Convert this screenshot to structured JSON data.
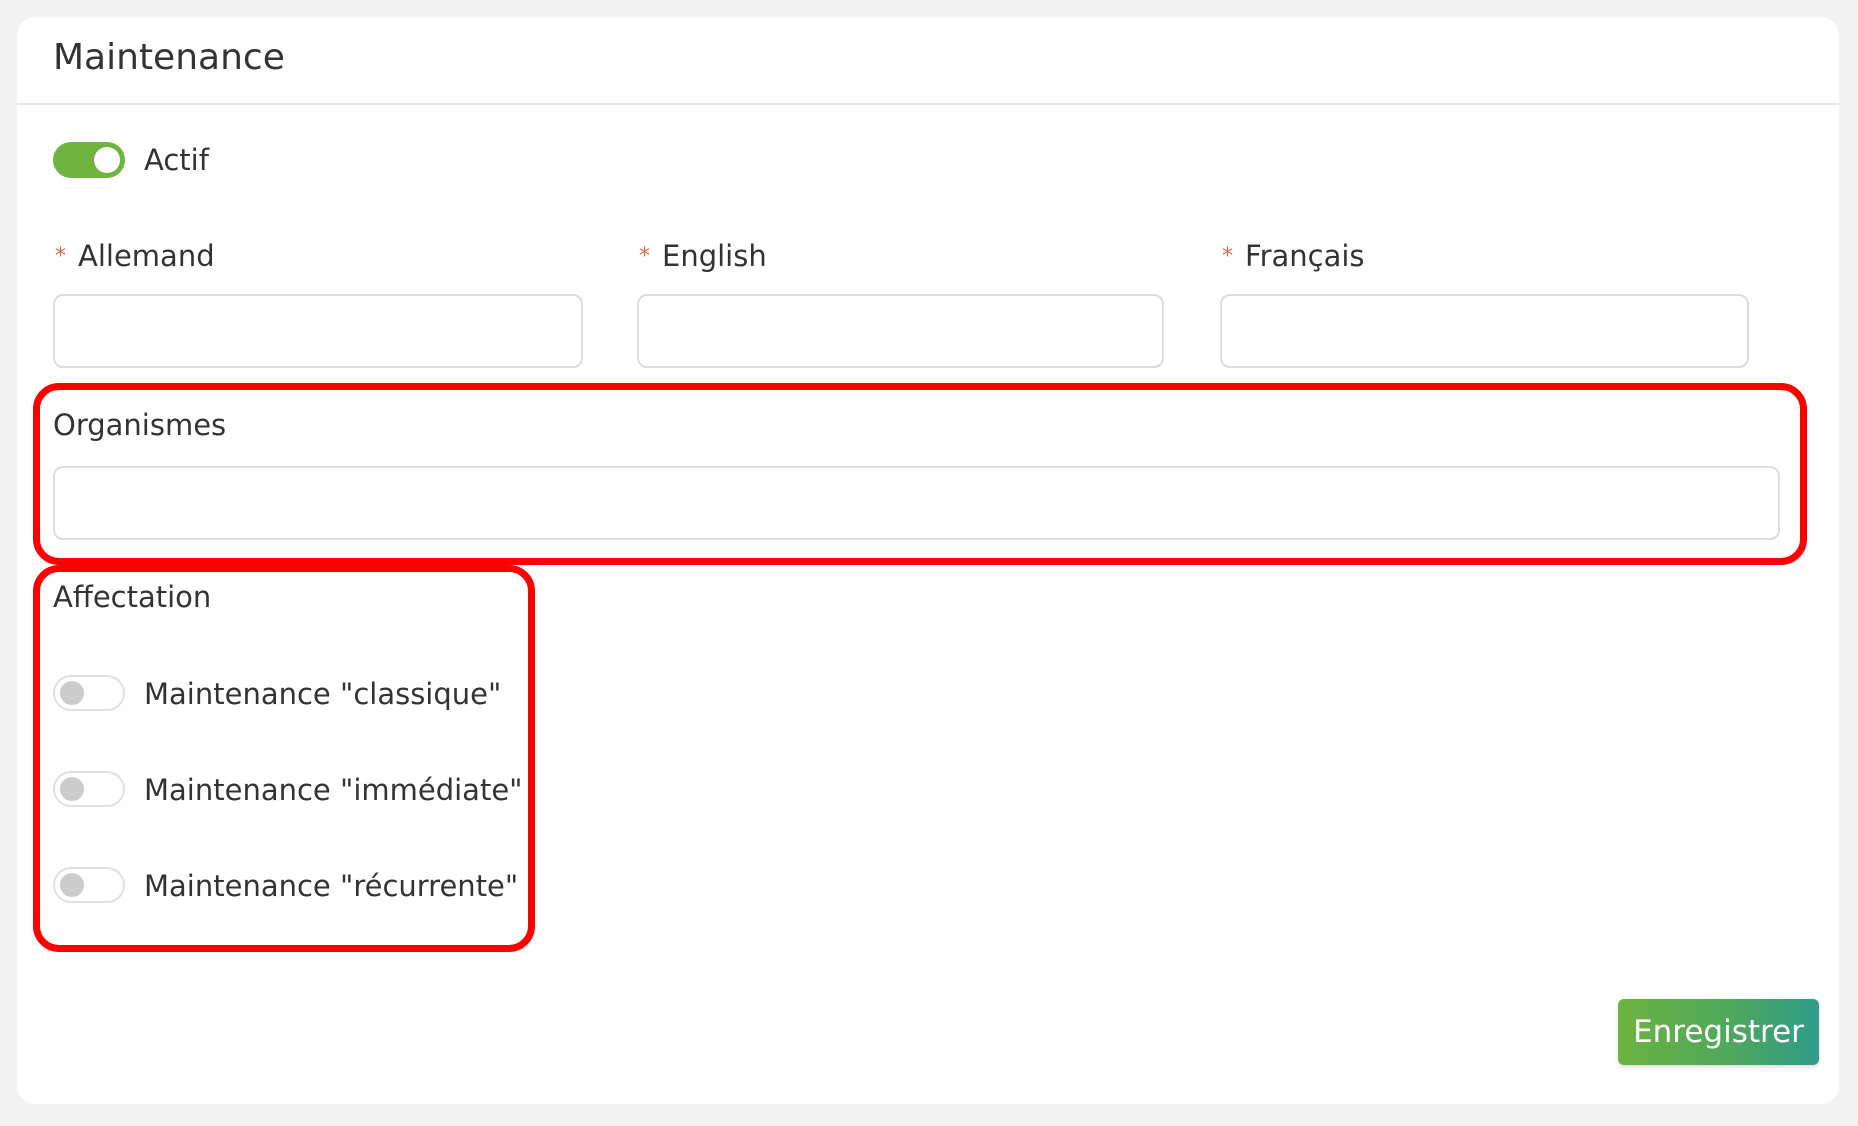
{
  "card": {
    "title": "Maintenance"
  },
  "active_toggle": {
    "label": "Actif",
    "checked": true,
    "color": "#6fb43f"
  },
  "name_fields": [
    {
      "label": "Allemand",
      "required_mark": "*",
      "value": "",
      "placeholder": ""
    },
    {
      "label": "English",
      "required_mark": "*",
      "value": "",
      "placeholder": ""
    },
    {
      "label": "Français",
      "required_mark": "*",
      "value": "",
      "placeholder": ""
    }
  ],
  "organismes": {
    "label": "Organismes",
    "value": "",
    "placeholder": ""
  },
  "affectation": {
    "label": "Affectation",
    "options": [
      {
        "label": "Maintenance \"classique\"",
        "checked": false
      },
      {
        "label": "Maintenance \"immédiate\"",
        "checked": false
      },
      {
        "label": "Maintenance \"récurrente\"",
        "checked": false
      }
    ]
  },
  "save_button": {
    "label": "Enregistrer"
  },
  "colors": {
    "accent_green": "#6fb43f",
    "highlight_red": "#ff0000",
    "required_mark": "#e06a4a"
  }
}
